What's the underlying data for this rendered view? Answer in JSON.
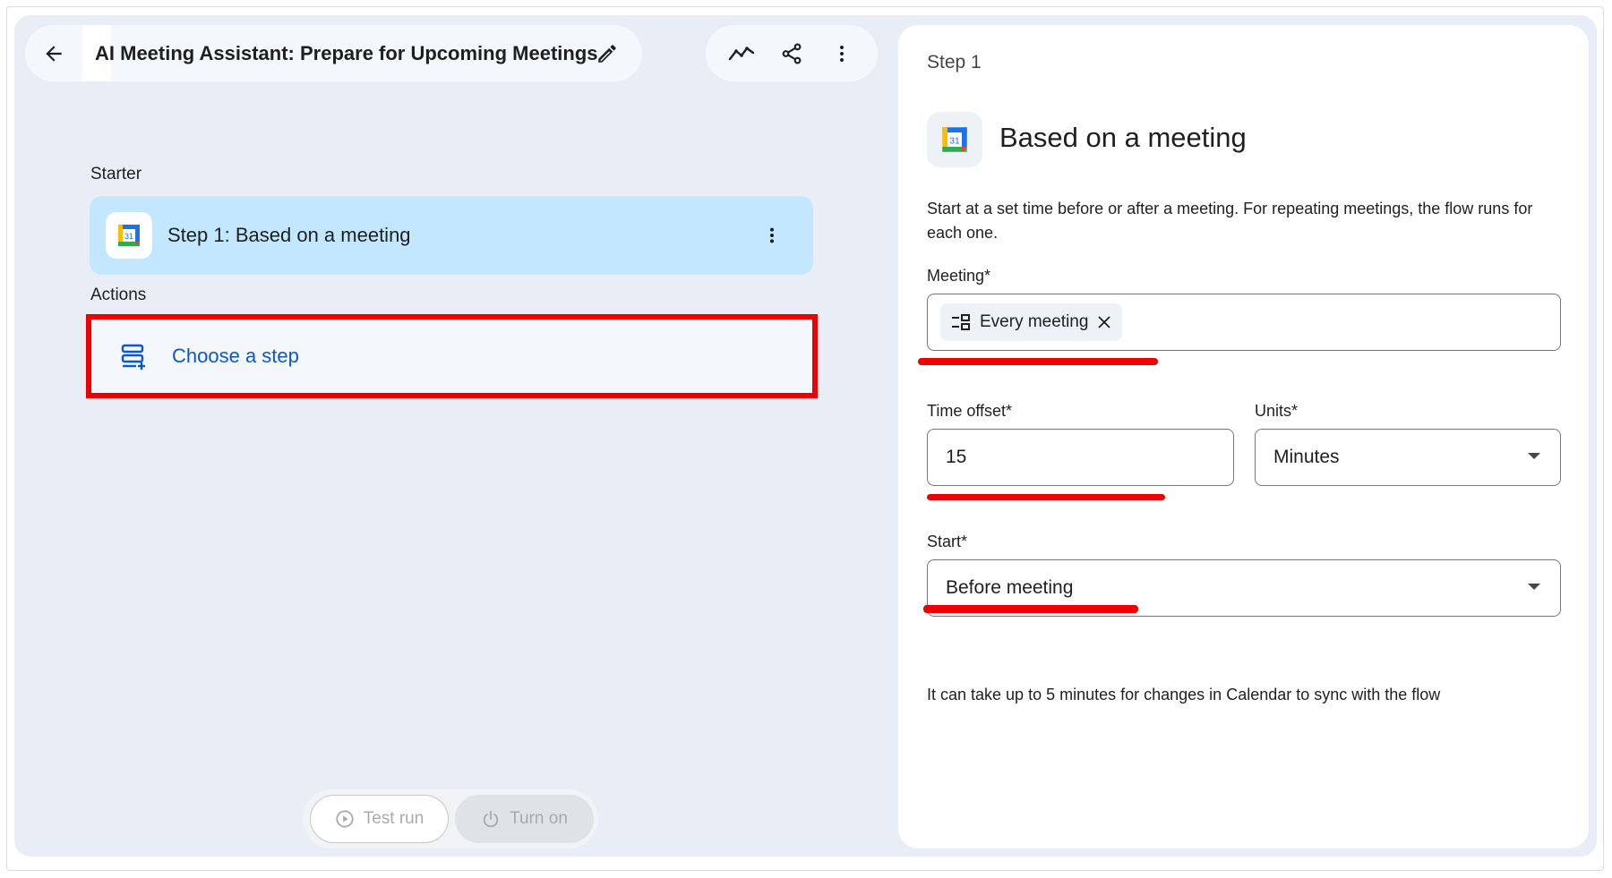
{
  "header": {
    "title": "AI Meeting Assistant: Prepare for Upcoming Meetings"
  },
  "icons": {
    "back": "arrow-left-icon",
    "edit": "pencil-icon",
    "activity": "activity-icon",
    "share": "share-icon",
    "more": "more-vert-icon",
    "calendar": "google-calendar-icon",
    "add_step": "add-step-icon",
    "play": "play-circle-icon",
    "power": "power-icon",
    "meeting_list": "meeting-list-icon",
    "close": "close-icon"
  },
  "flow": {
    "starter_label": "Starter",
    "starter_step_prefix": "Step 1:",
    "starter_step_name": "Based on a meeting",
    "calendar_day": "31",
    "actions_label": "Actions",
    "choose_step_label": "Choose a step"
  },
  "footer": {
    "test_run_label": "Test run",
    "turn_on_label": "Turn on"
  },
  "panel": {
    "step_label": "Step 1",
    "title": "Based on a meeting",
    "calendar_day": "31",
    "description": "Start at a set time before or after a meeting. For repeating meetings, the flow runs for each one.",
    "meeting_label": "Meeting*",
    "meeting_chip": "Every meeting",
    "time_offset_label": "Time offset*",
    "time_offset_value": "15",
    "units_label": "Units*",
    "units_value": "Minutes",
    "start_label": "Start*",
    "start_value": "Before meeting",
    "note": "It can take up to 5 minutes for changes in Calendar to sync with the flow"
  },
  "colors": {
    "highlight": "#ee0000",
    "accent": "#0b57d0",
    "starter_card": "#c2e7ff"
  }
}
